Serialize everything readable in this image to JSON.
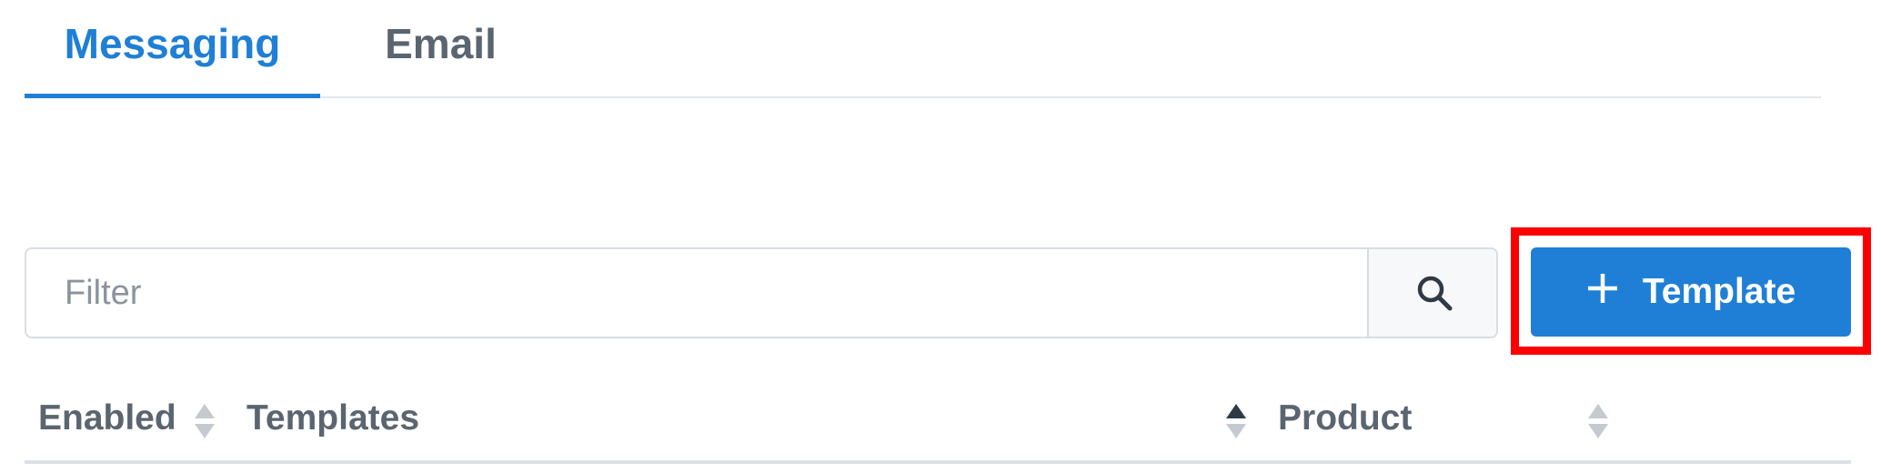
{
  "tabs": [
    {
      "label": "Messaging",
      "active": true
    },
    {
      "label": "Email",
      "active": false
    }
  ],
  "filter": {
    "placeholder": "Filter",
    "value": "",
    "search_icon": "search-icon"
  },
  "actions": {
    "add_template_icon": "plus-icon",
    "add_template_label": "Template",
    "highlighted": true
  },
  "table": {
    "columns": [
      {
        "label": "Enabled",
        "sort": "none"
      },
      {
        "label": "Templates",
        "sort": "ascending"
      },
      {
        "label": "Product",
        "sort": "none"
      }
    ]
  },
  "colors": {
    "accent": "#1f7fd6",
    "text_muted": "#5a6570",
    "highlight": "#ff0000"
  }
}
